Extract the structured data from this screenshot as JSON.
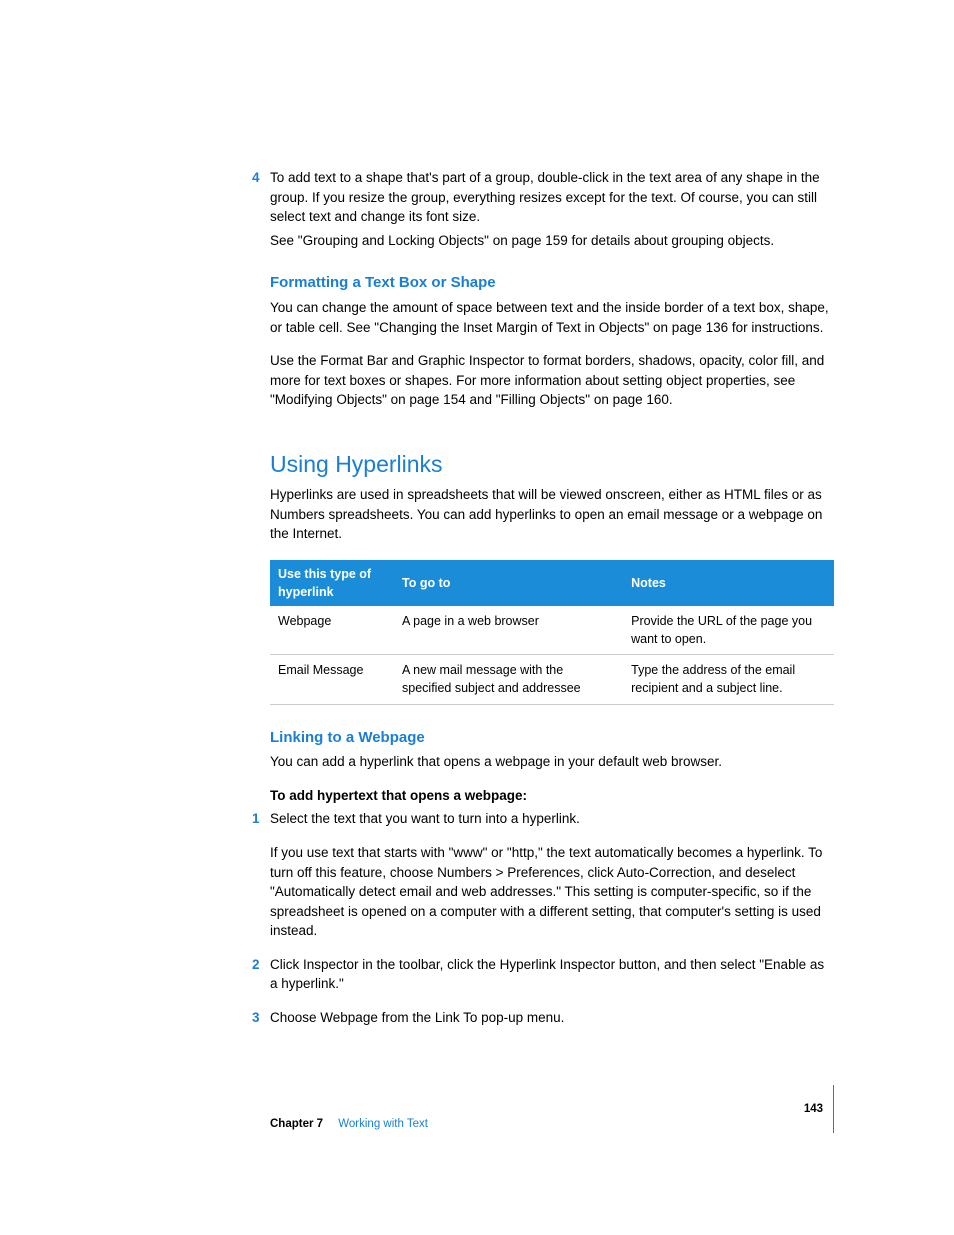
{
  "steps_top": {
    "num4": "4",
    "step4_p1": "To add text to a shape that's part of a group, double-click in the text area of any shape in the group. If you resize the group, everything resizes except for the text. Of course, you can still select text and change its font size.",
    "step4_p2": "See \"Grouping and Locking Objects\" on page 159 for details about grouping objects."
  },
  "formatting": {
    "heading": "Formatting a Text Box or Shape",
    "p1": "You can change the amount of space between text and the inside border of a text box, shape, or table cell. See \"Changing the Inset Margin of Text in Objects\" on page 136 for instructions.",
    "p2": "Use the Format Bar and Graphic Inspector to format borders, shadows, opacity, color fill, and more for text boxes or shapes. For more information about setting object properties, see \"Modifying Objects\" on page 154 and \"Filling Objects\" on page 160."
  },
  "hyperlinks": {
    "heading": "Using Hyperlinks",
    "intro": "Hyperlinks are used in spreadsheets that will be viewed onscreen, either as HTML files or as Numbers spreadsheets. You can add hyperlinks to open an email message or a webpage on the Internet.",
    "table": {
      "head1": "Use this type of hyperlink",
      "head2": "To go to",
      "head3": "Notes",
      "rows": [
        {
          "c1": "Webpage",
          "c2": "A page in a web browser",
          "c3": "Provide the URL of the page you want to open."
        },
        {
          "c1": "Email Message",
          "c2": "A new mail message with the specified subject and addressee",
          "c3": "Type the address of the email recipient and a subject line."
        }
      ]
    }
  },
  "linking": {
    "heading": "Linking to a Webpage",
    "intro": "You can add a hyperlink that opens a webpage in your default web browser.",
    "lead": "To add hypertext that opens a webpage:",
    "num1": "1",
    "step1_p1": "Select the text that you want to turn into a hyperlink.",
    "step1_p2": "If you use text that starts with \"www\" or \"http,\" the text automatically becomes a hyperlink. To turn off this feature, choose Numbers > Preferences, click Auto-Correction, and deselect \"Automatically detect email and web addresses.\" This setting is computer-specific, so if the spreadsheet is opened on a computer with a different setting, that computer's setting is used instead.",
    "num2": "2",
    "step2": "Click Inspector in the toolbar, click the Hyperlink Inspector button, and then select \"Enable as a hyperlink.\"",
    "num3": "3",
    "step3": "Choose Webpage from the Link To pop-up menu."
  },
  "footer": {
    "chapter_label": "Chapter 7",
    "chapter_title": "Working with Text",
    "page_number": "143"
  }
}
